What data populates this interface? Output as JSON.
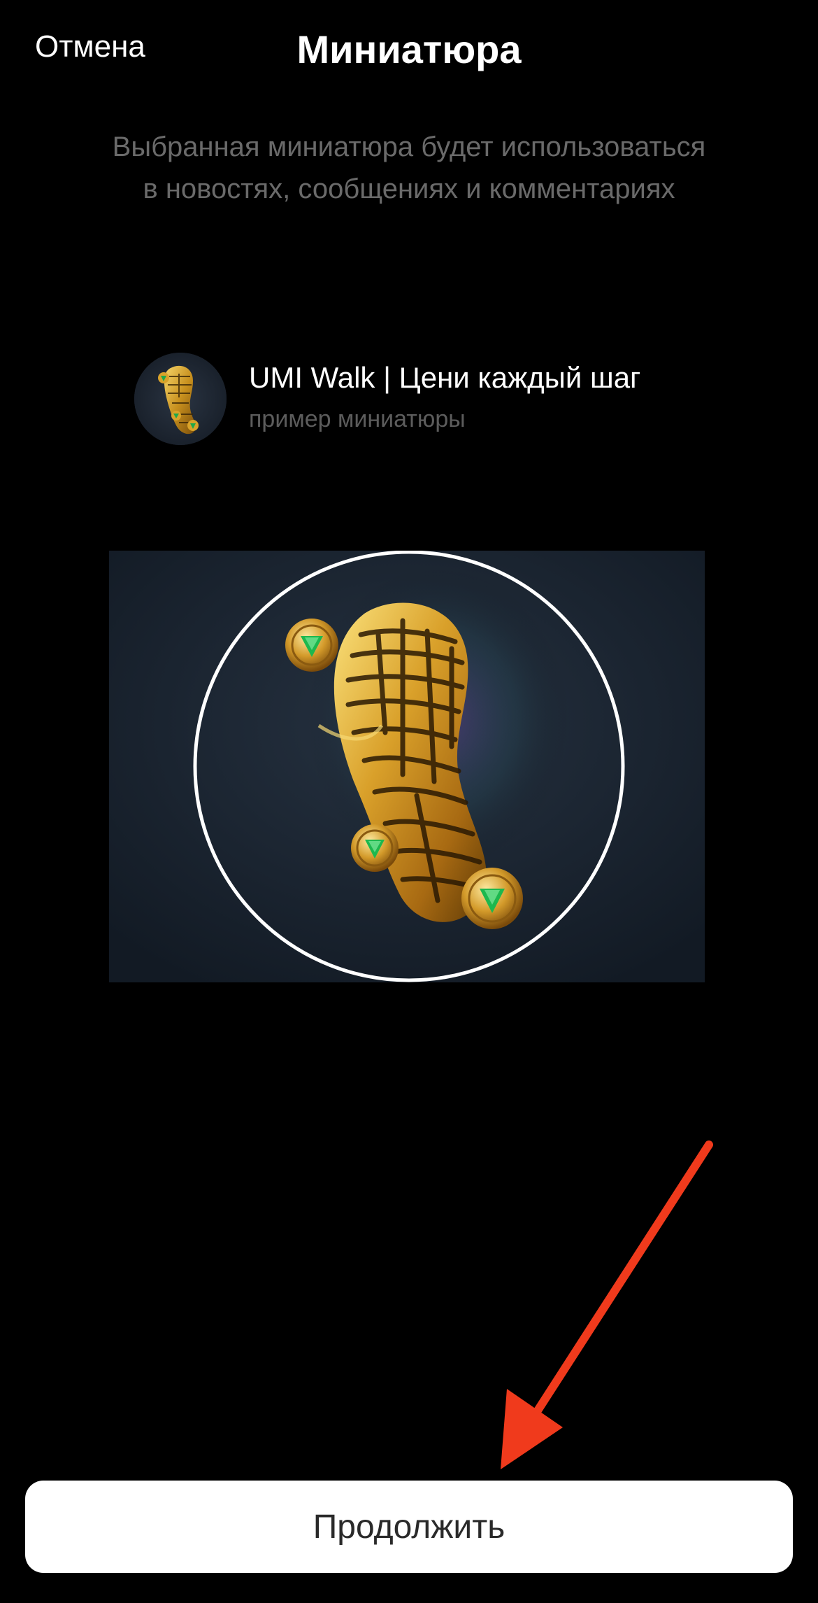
{
  "header": {
    "cancel_label": "Отмена",
    "title": "Миниатюра"
  },
  "description": {
    "line1": "Выбранная миниатюра будет использоваться",
    "line2": "в новостях, сообщениях и комментариях"
  },
  "preview": {
    "title": "UMI Walk | Цени каждый шаг",
    "subtitle": "пример миниатюры",
    "avatar_icon": "golden-shoe-sole-icon"
  },
  "crop": {
    "image_icon": "golden-shoe-sole-icon",
    "background_color": "#182230",
    "circle_color": "#ffffff"
  },
  "annotation": {
    "arrow_color": "#f03a1c"
  },
  "footer": {
    "continue_label": "Продолжить"
  }
}
